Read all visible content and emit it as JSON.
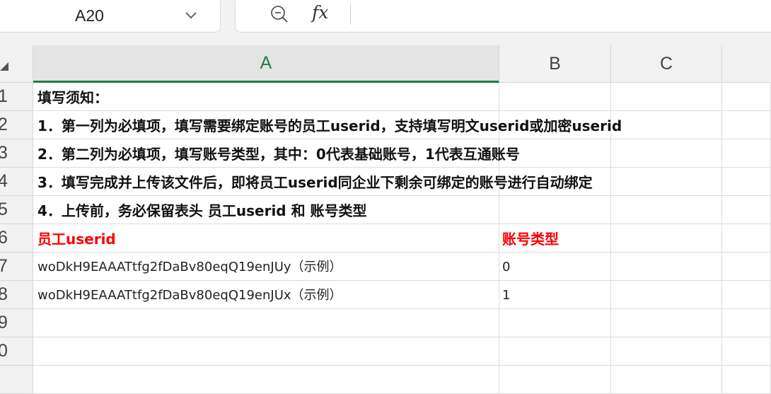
{
  "formula_bar": {
    "cell_ref": "A20",
    "fx_label": "fx",
    "formula_value": ""
  },
  "columns": [
    "A",
    "B",
    "C"
  ],
  "rows": [
    "1",
    "2",
    "3",
    "4",
    "5",
    "6",
    "7",
    "8",
    "9",
    "0"
  ],
  "cells": {
    "A1": "填写须知：",
    "A2": "1．第一列为必填项，填写需要绑定账号的员工userid，支持填写明文userid或加密userid",
    "A3": "2．第二列为必填项，填写账号类型，其中：0代表基础账号，1代表互通账号",
    "A4": "3．填写完成并上传该文件后，即将员工userid同企业下剩余可绑定的账号进行自动绑定",
    "A5": "4．上传前，务必保留表头 员工userid 和 账号类型",
    "A6": "员工userid",
    "B6": "账号类型",
    "A7": "woDkH9EAAATtfg2fDaBv80eqQ19enJUy（示例）",
    "B7": "0",
    "A8": "woDkH9EAAATtfg2fDaBv80eqQ19enJUx（示例）",
    "B8": "1"
  },
  "colors": {
    "header_bg": "#f2f2f2",
    "active_accent": "#1e7e45",
    "header_text_red": "#ff0000"
  },
  "icons": [
    "chevron-down-icon",
    "zoom-formula-icon",
    "select-all-icon"
  ]
}
